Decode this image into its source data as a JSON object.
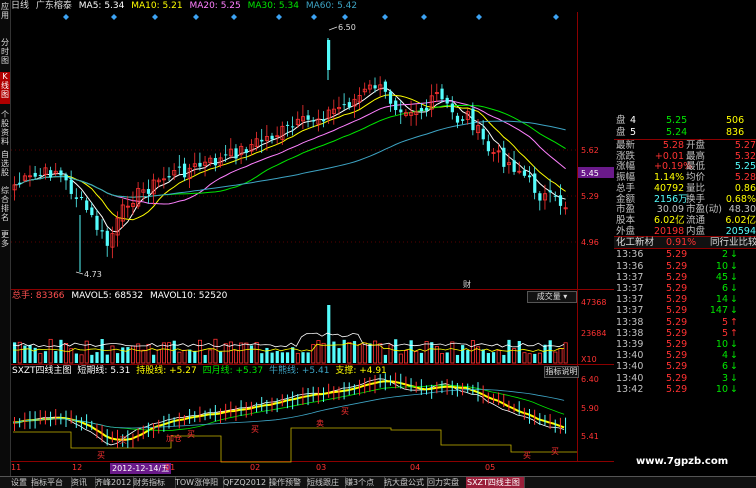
{
  "colors": {
    "bg": "#000000",
    "up": "#ff3232",
    "down": "#54fcfc",
    "ma5": "#ffffff",
    "ma10": "#ffff00",
    "ma20": "#ff80ff",
    "ma30": "#00e600",
    "ma60": "#3da3c3",
    "volume_label": "#ff5050",
    "accent": "#9a1f3a"
  },
  "top": {
    "period": "日线",
    "name": "广东榕泰",
    "ma5": "MA5: 5.34",
    "ma10": "MA10: 5.21",
    "ma20": "MA20: 5.25",
    "ma30": "MA30: 5.34",
    "ma60": "MA60: 5.42"
  },
  "nav": [
    {
      "label": "应用",
      "active": false
    },
    {
      "label": "分时图",
      "active": false
    },
    {
      "label": "K线图",
      "active": true
    },
    {
      "label": "个股资料",
      "active": false
    },
    {
      "label": "自选股",
      "active": false
    },
    {
      "label": "综合排名",
      "active": false
    },
    {
      "label": "更多",
      "active": false
    }
  ],
  "main_chart": {
    "high_label": "6.50",
    "low_label": "4.73",
    "price_ticks": [
      "5.62",
      "5.29",
      "4.96"
    ],
    "current_price": "5.45",
    "marker_label": "财"
  },
  "volume": {
    "label": "总手: 83366",
    "mavol5": "MAVOL5: 68532",
    "mavol10": "MAVOL10: 52520",
    "dropdown": "成交量",
    "ticks": [
      "47368",
      "23684"
    ],
    "multiplier": "X10"
  },
  "indicator": {
    "name": "SXZT四线主图",
    "short_line": "短期线: 5.31",
    "hold_line": "持股线: +5.27",
    "four_line": "四月线: +5.37",
    "bull_bear_line": "牛熊线: +5.41",
    "support": "支撑: +4.91",
    "explain_button": "指标说明",
    "ticks": [
      "6.40",
      "5.90",
      "5.41"
    ],
    "buy_label": "买",
    "sell_label": "卖",
    "add_label": "加仓"
  },
  "xaxis": {
    "labels": [
      "11",
      "12",
      "01",
      "02",
      "03",
      "04",
      "05"
    ],
    "highlight_date": "2012-12-14/五"
  },
  "quote": {
    "bid_rows": [
      {
        "label": "盘",
        "level": "4",
        "price": "5.25",
        "volume": "506"
      },
      {
        "label": "盘",
        "level": "5",
        "price": "5.24",
        "volume": "836"
      }
    ],
    "stats": [
      {
        "l1": "最新",
        "v1": "5.28",
        "l2": "开盘",
        "v2": "5.27",
        "c1": "#ff3232",
        "c2": "#ff3232"
      },
      {
        "l1": "涨跌",
        "v1": "+0.01",
        "l2": "最高",
        "v2": "5.32",
        "c1": "#ff3232",
        "c2": "#ff3232"
      },
      {
        "l1": "涨幅",
        "v1": "+0.19%",
        "l2": "最低",
        "v2": "5.25",
        "c1": "#ff3232",
        "c2": "#54fcfc"
      },
      {
        "l1": "振幅",
        "v1": "1.14%",
        "l2": "均价",
        "v2": "5.28",
        "c1": "#ffff00",
        "c2": "#ff3232"
      },
      {
        "l1": "总手",
        "v1": "40792",
        "l2": "量比",
        "v2": "0.86",
        "c1": "#ffff00",
        "c2": "#ffff00"
      },
      {
        "l1": "金额",
        "v1": "2156万",
        "l2": "换手",
        "v2": "0.68%",
        "c1": "#54fcfc",
        "c2": "#ffff00"
      },
      {
        "l1": "市盈",
        "v1": "30.09",
        "l2": "市盈(动)",
        "v2": "48.30",
        "c1": "#c0c0c0",
        "c2": "#c0c0c0"
      },
      {
        "l1": "股本",
        "v1": "6.02亿",
        "l2": "流通",
        "v2": "6.02亿",
        "c1": "#ffff00",
        "c2": "#ffff00"
      },
      {
        "l1": "外盘",
        "v1": "20198",
        "l2": "内盘",
        "v2": "20594",
        "c1": "#ff3232",
        "c2": "#54fcfc"
      }
    ],
    "industry": {
      "name": "化工新材",
      "change": "0.91%",
      "compare": "同行业比较"
    },
    "ticks": [
      {
        "time": "13:36",
        "price": "5.29",
        "vol": "2",
        "dir": "down"
      },
      {
        "time": "13:36",
        "price": "5.29",
        "vol": "10",
        "dir": "down"
      },
      {
        "time": "13:37",
        "price": "5.29",
        "vol": "45",
        "dir": "down"
      },
      {
        "time": "13:37",
        "price": "5.29",
        "vol": "6",
        "dir": "down"
      },
      {
        "time": "13:37",
        "price": "5.29",
        "vol": "14",
        "dir": "down"
      },
      {
        "time": "13:37",
        "price": "5.29",
        "vol": "147",
        "dir": "down"
      },
      {
        "time": "13:38",
        "price": "5.29",
        "vol": "5",
        "dir": "up"
      },
      {
        "time": "13:38",
        "price": "5.29",
        "vol": "5",
        "dir": "up"
      },
      {
        "time": "13:39",
        "price": "5.29",
        "vol": "10",
        "dir": "down"
      },
      {
        "time": "13:40",
        "price": "5.29",
        "vol": "4",
        "dir": "down"
      },
      {
        "time": "13:40",
        "price": "5.29",
        "vol": "6",
        "dir": "down"
      },
      {
        "time": "13:40",
        "price": "5.29",
        "vol": "3",
        "dir": "down"
      },
      {
        "time": "13:42",
        "price": "5.29",
        "vol": "10",
        "dir": "down"
      }
    ]
  },
  "tabs": [
    {
      "label": "设置",
      "active": false
    },
    {
      "label": "指标平台",
      "active": false
    },
    {
      "label": "资讯",
      "active": false
    },
    {
      "label": "齐峰2012",
      "active": false
    },
    {
      "label": "财务指标",
      "active": false
    },
    {
      "label": "TOW涨停阳",
      "active": false
    },
    {
      "label": "QFZQ2012",
      "active": false
    },
    {
      "label": "操作预警",
      "active": false
    },
    {
      "label": "短线跟庄",
      "active": false
    },
    {
      "label": "赚3个点",
      "active": false
    },
    {
      "label": "抗大盘公式",
      "active": false
    },
    {
      "label": "回力实盘",
      "active": false
    },
    {
      "label": "SXZT四线主图",
      "active": true
    }
  ],
  "watermark": "www.7gpzb.com"
}
